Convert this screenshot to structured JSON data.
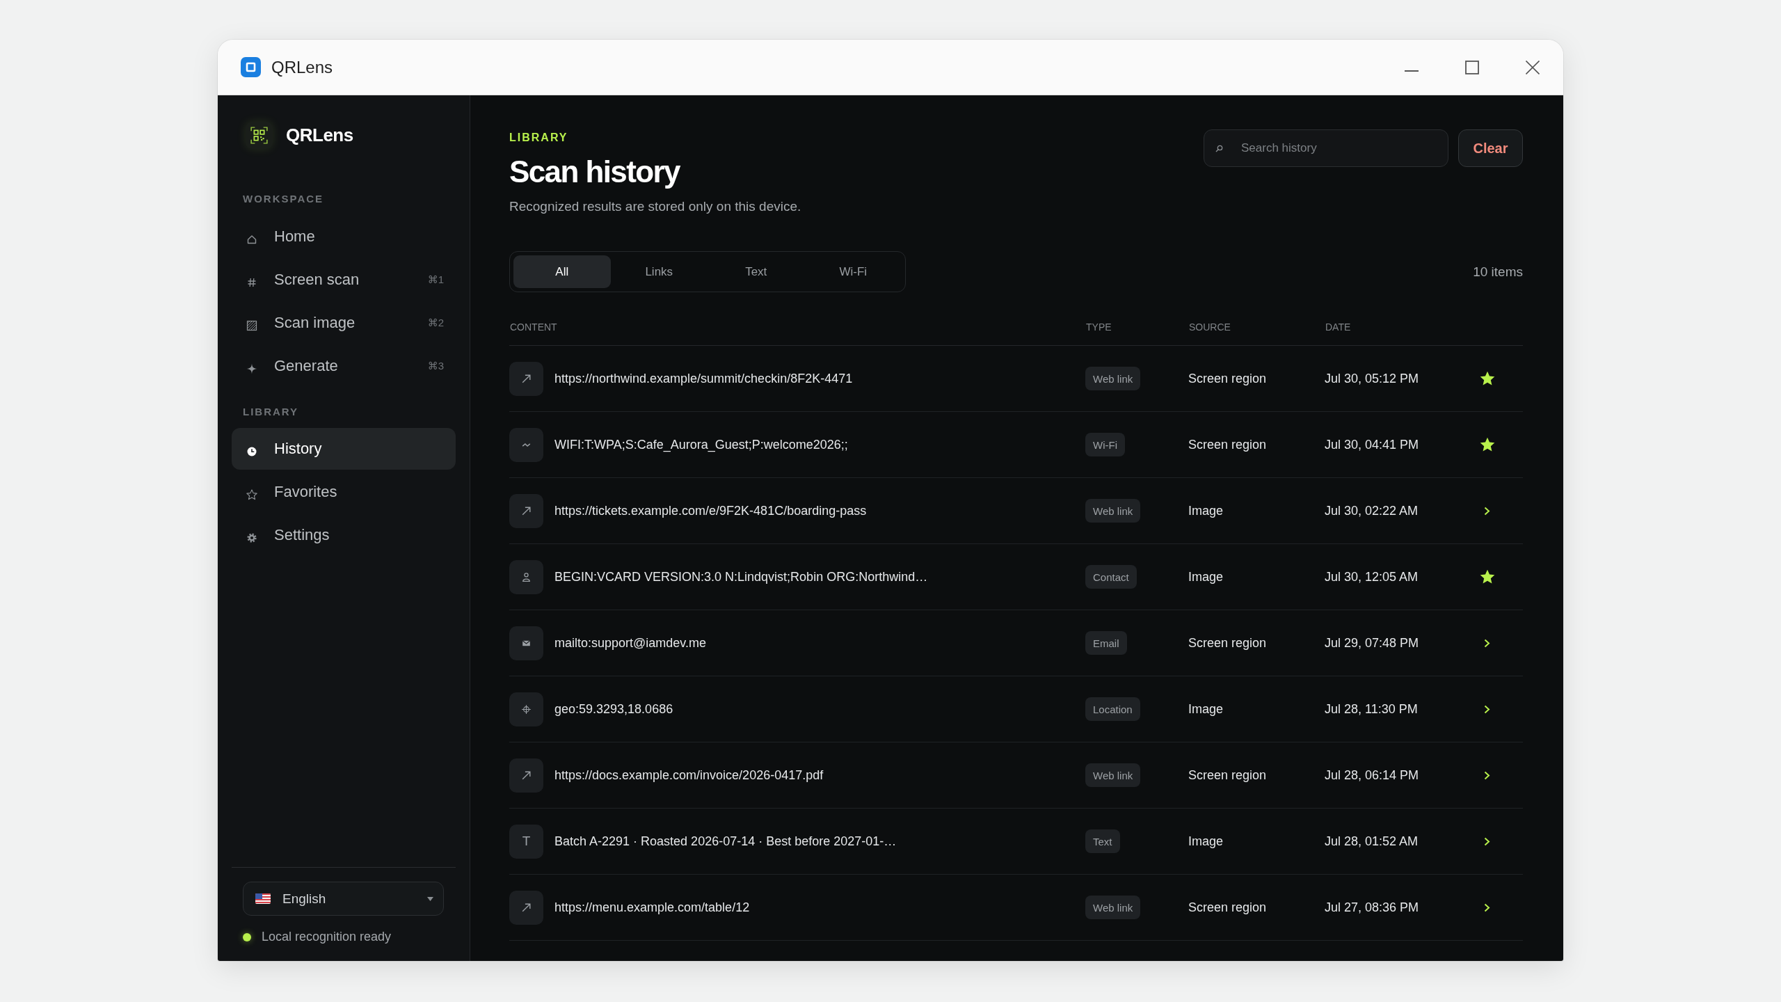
{
  "window": {
    "title": "QRLens"
  },
  "sidebar": {
    "brand": "QRLens",
    "sections": [
      {
        "label": "WORKSPACE",
        "items": [
          {
            "label": "Home",
            "selected": false
          },
          {
            "label": "Screen scan",
            "shortcut": "⌘1",
            "selected": false
          },
          {
            "label": "Scan image",
            "shortcut": "⌘2",
            "selected": false
          },
          {
            "label": "Generate",
            "shortcut": "⌘3",
            "selected": false
          }
        ]
      },
      {
        "label": "LIBRARY",
        "items": [
          {
            "label": "History",
            "selected": true
          },
          {
            "label": "Favorites",
            "selected": false
          },
          {
            "label": "Settings",
            "selected": false
          }
        ]
      }
    ],
    "language": {
      "value": "English"
    },
    "status": {
      "text": "Local recognition ready",
      "ready": true
    }
  },
  "header": {
    "eyebrow": "LIBRARY",
    "title": "Scan history",
    "subtitle": "Recognized results are stored only on this device."
  },
  "search": {
    "placeholder": "Search history"
  },
  "clear_button": "Clear",
  "tabs": [
    {
      "label": "All",
      "selected": true
    },
    {
      "label": "Links",
      "selected": false
    },
    {
      "label": "Text",
      "selected": false
    },
    {
      "label": "Wi-Fi",
      "selected": false
    }
  ],
  "count": "10 items",
  "table": {
    "columns": [
      "CONTENT",
      "TYPE",
      "SOURCE",
      "DATE"
    ],
    "rows": [
      {
        "kind": "link",
        "content": "https://northwind.example/summit/checkin/8F2K-4471",
        "type": "Web link",
        "source": "Screen region",
        "date": "Jul 30, 05:12 PM",
        "favorite": true
      },
      {
        "kind": "wifi",
        "content": "WIFI:T:WPA;S:Cafe_Aurora_Guest;P:welcome2026;;",
        "type": "Wi-Fi",
        "source": "Screen region",
        "date": "Jul 30, 04:41 PM",
        "favorite": true
      },
      {
        "kind": "link",
        "content": "https://tickets.example.com/e/9F2K-481C/boarding-pass",
        "type": "Web link",
        "source": "Image",
        "date": "Jul 30, 02:22 AM",
        "favorite": false
      },
      {
        "kind": "contact",
        "content": "BEGIN:VCARD VERSION:3.0 N:Lindqvist;Robin ORG:Northwind…",
        "type": "Contact",
        "source": "Image",
        "date": "Jul 30, 12:05 AM",
        "favorite": true
      },
      {
        "kind": "email",
        "content": "mailto:support@iamdev.me",
        "type": "Email",
        "source": "Screen region",
        "date": "Jul 29, 07:48 PM",
        "favorite": false
      },
      {
        "kind": "location",
        "content": "geo:59.3293,18.0686",
        "type": "Location",
        "source": "Image",
        "date": "Jul 28, 11:30 PM",
        "favorite": false
      },
      {
        "kind": "link",
        "content": "https://docs.example.com/invoice/2026-0417.pdf",
        "type": "Web link",
        "source": "Screen region",
        "date": "Jul 28, 06:14 PM",
        "favorite": false
      },
      {
        "kind": "text",
        "icon_text": "T",
        "content": "Batch A-2291 · Roasted 2026-07-14 · Best before 2027-01-…",
        "type": "Text",
        "source": "Image",
        "date": "Jul 28, 01:52 AM",
        "favorite": false
      },
      {
        "kind": "link",
        "content": "https://menu.example.com/table/12",
        "type": "Web link",
        "source": "Screen region",
        "date": "Jul 27, 08:36 PM",
        "favorite": false
      }
    ]
  }
}
